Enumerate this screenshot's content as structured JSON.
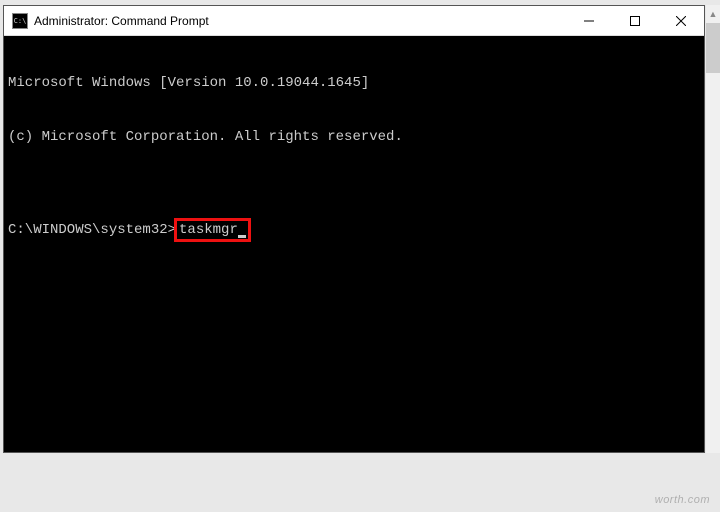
{
  "titlebar": {
    "icon_label": "C:\\",
    "title": "Administrator: Command Prompt"
  },
  "terminal": {
    "line1": "Microsoft Windows [Version 10.0.19044.1645]",
    "line2": "(c) Microsoft Corporation. All rights reserved.",
    "blank": "",
    "prompt": "C:\\WINDOWS\\system32>",
    "command": "taskmgr"
  },
  "watermark": "worth.com"
}
